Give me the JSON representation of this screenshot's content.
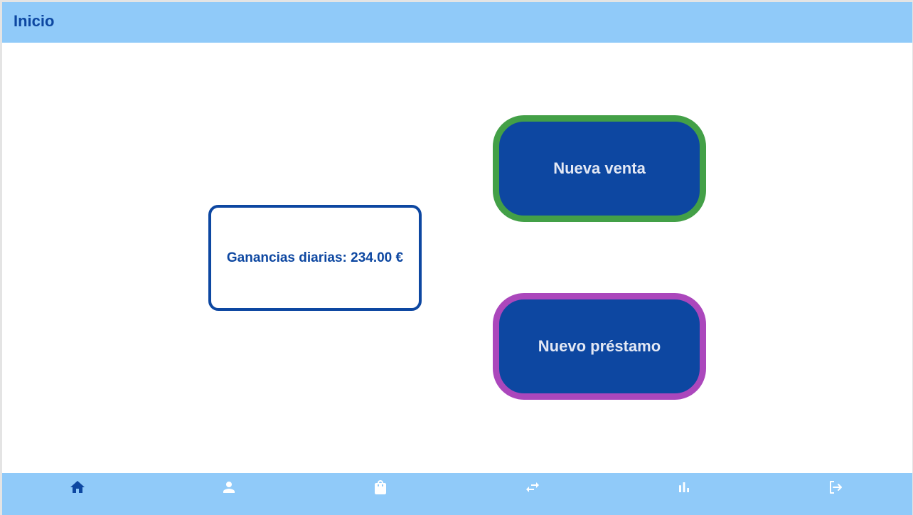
{
  "header": {
    "title": "Inicio"
  },
  "main": {
    "earnings_label": "Ganancias diarias: 234.00 €",
    "new_sale_label": "Nueva venta",
    "new_loan_label": "Nuevo préstamo"
  },
  "bottom_nav": {
    "items": [
      {
        "icon": "home-icon",
        "active": true
      },
      {
        "icon": "person-icon",
        "active": false
      },
      {
        "icon": "shopping-bag-icon",
        "active": false
      },
      {
        "icon": "swap-arrows-icon",
        "active": false
      },
      {
        "icon": "bar-chart-icon",
        "active": false
      },
      {
        "icon": "logout-icon",
        "active": false
      }
    ]
  },
  "colors": {
    "bar_background": "#90caf9",
    "primary": "#0d47a1",
    "new_sale_border": "#43a047",
    "new_loan_border": "#ab47bc",
    "inactive_icon": "#ffffff"
  }
}
